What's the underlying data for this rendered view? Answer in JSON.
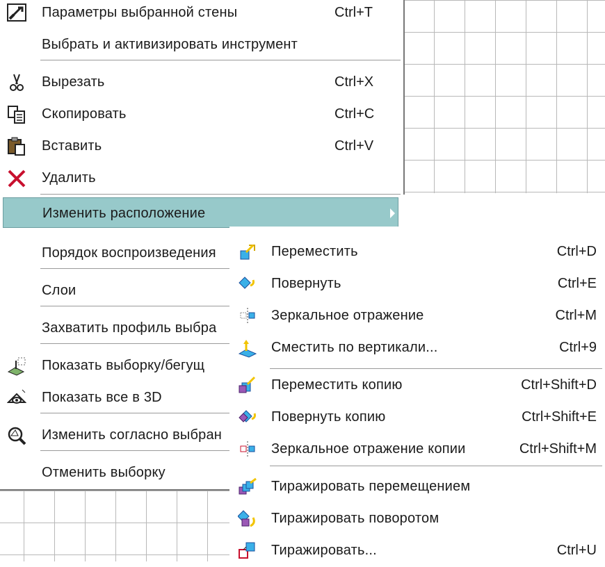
{
  "main_menu": {
    "items": [
      {
        "label": "Параметры выбранной стены",
        "shortcut": "Ctrl+T",
        "icon": "wall-params-icon"
      },
      {
        "label": "Выбрать и активизировать инструмент",
        "shortcut": ""
      },
      {
        "label": "Вырезать",
        "shortcut": "Ctrl+X",
        "icon": "scissors-icon"
      },
      {
        "label": "Скопировать",
        "shortcut": "Ctrl+C",
        "icon": "copy-icon"
      },
      {
        "label": "Вставить",
        "shortcut": "Ctrl+V",
        "icon": "paste-icon"
      },
      {
        "label": "Удалить",
        "shortcut": "",
        "icon": "delete-icon"
      },
      {
        "label": "Изменить расположение",
        "shortcut": "",
        "highlighted": true
      },
      {
        "label": "Порядок воспроизведения",
        "shortcut": ""
      },
      {
        "label": "Слои",
        "shortcut": ""
      },
      {
        "label": "Захватить профиль выбра",
        "shortcut": ""
      },
      {
        "label": "Показать выборку/бегущ",
        "shortcut": "",
        "icon": "show-selection-icon"
      },
      {
        "label": "Показать все в 3D",
        "shortcut": "",
        "icon": "show-3d-icon"
      },
      {
        "label": "Изменить согласно выбран",
        "shortcut": "",
        "icon": "modify-by-selection-icon"
      },
      {
        "label": "Отменить выборку",
        "shortcut": ""
      }
    ]
  },
  "submenu": {
    "items": [
      {
        "label": "Переместить",
        "shortcut": "Ctrl+D",
        "icon": "move-icon"
      },
      {
        "label": "Повернуть",
        "shortcut": "Ctrl+E",
        "icon": "rotate-icon"
      },
      {
        "label": "Зеркальное отражение",
        "shortcut": "Ctrl+M",
        "icon": "mirror-icon"
      },
      {
        "label": "Сместить по вертикали...",
        "shortcut": "Ctrl+9",
        "icon": "elevate-icon"
      },
      {
        "label": "Переместить копию",
        "shortcut": "Ctrl+Shift+D",
        "icon": "move-copy-icon"
      },
      {
        "label": "Повернуть копию",
        "shortcut": "Ctrl+Shift+E",
        "icon": "rotate-copy-icon"
      },
      {
        "label": "Зеркальное отражение копии",
        "shortcut": "Ctrl+Shift+M",
        "icon": "mirror-copy-icon"
      },
      {
        "label": "Тиражировать перемещением",
        "shortcut": "",
        "icon": "multiply-move-icon"
      },
      {
        "label": "Тиражировать поворотом",
        "shortcut": "",
        "icon": "multiply-rotate-icon"
      },
      {
        "label": "Тиражировать...",
        "shortcut": "Ctrl+U",
        "icon": "multiply-icon"
      }
    ]
  },
  "colors": {
    "highlight": "#97c9ca",
    "icon_blue": "#1e7fd6",
    "icon_yellow": "#f2c400",
    "icon_red": "#c8102e"
  }
}
